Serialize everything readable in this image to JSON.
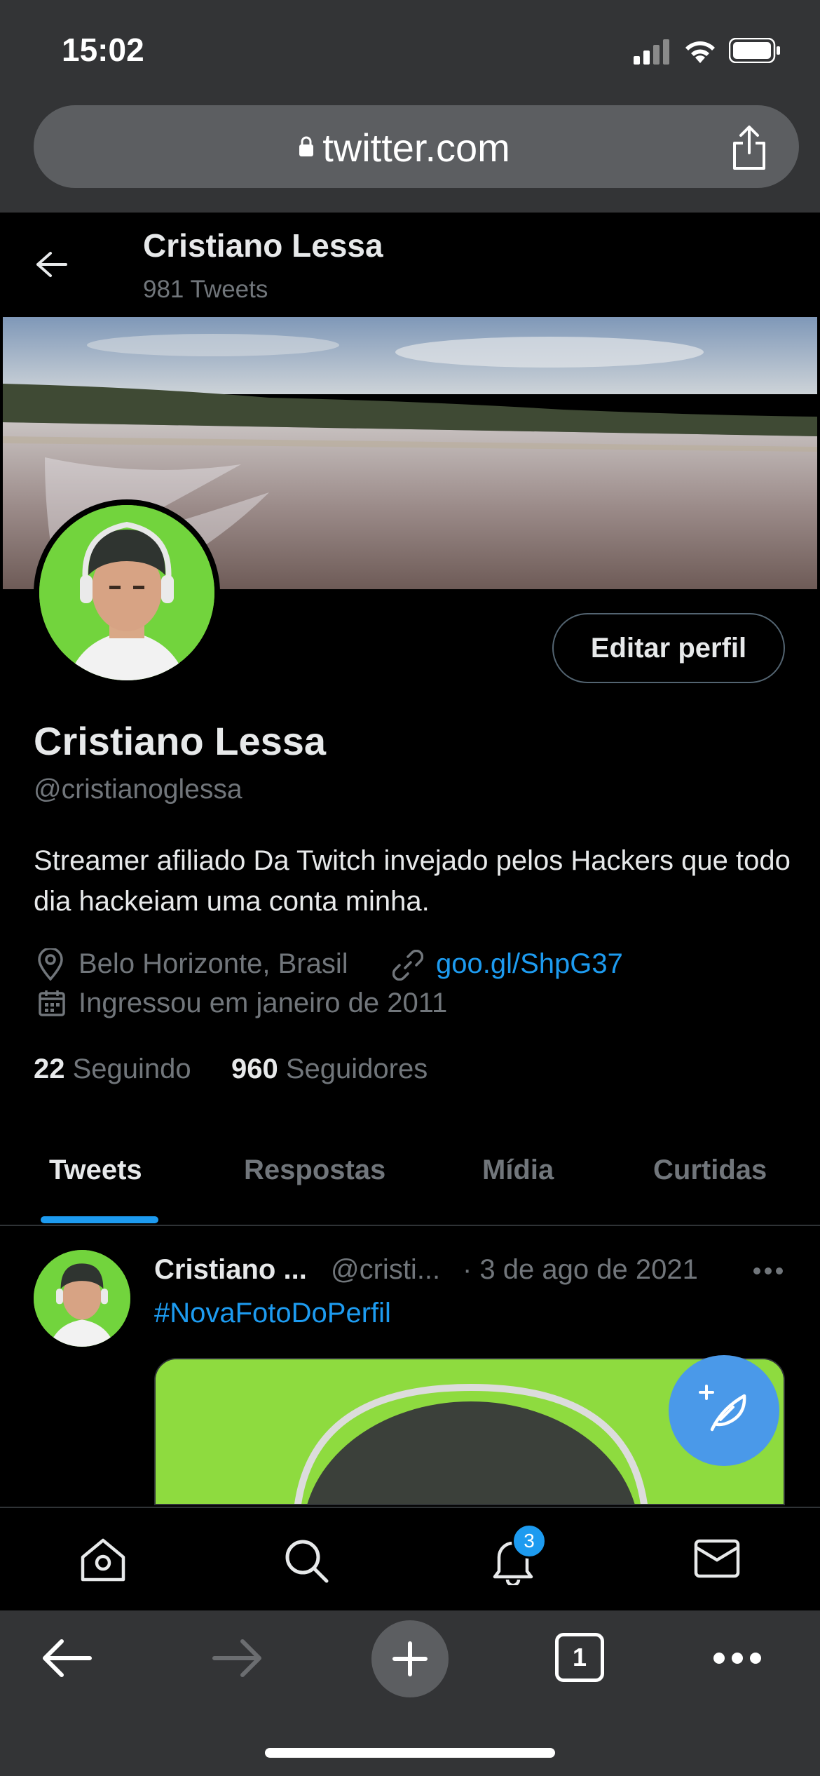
{
  "status_bar": {
    "time": "15:02"
  },
  "browser": {
    "url": "twitter.com"
  },
  "header": {
    "name": "Cristiano Lessa",
    "tweet_count": "981 Tweets"
  },
  "profile": {
    "edit_button": "Editar perfil",
    "display_name": "Cristiano Lessa",
    "handle": "@cristianoglessa",
    "bio": "Streamer afiliado Da Twitch invejado pelos Hackers que todo dia hackeiam uma conta minha.",
    "location": "Belo Horizonte, Brasil",
    "link": "goo.gl/ShpG37",
    "joined": "Ingressou em janeiro de 2011",
    "following_count": "22",
    "following_label": "Seguindo",
    "followers_count": "960",
    "followers_label": "Seguidores"
  },
  "tabs": [
    {
      "label": "Tweets",
      "active": true
    },
    {
      "label": "Respostas",
      "active": false
    },
    {
      "label": "Mídia",
      "active": false
    },
    {
      "label": "Curtidas",
      "active": false
    }
  ],
  "tweet": {
    "name": "Cristiano ...",
    "handle": "@cristi...",
    "date": "· 3 de ago de 2021",
    "text": "#NovaFotoDoPerfil"
  },
  "bottom_nav": {
    "notification_badge": "3"
  },
  "safari_toolbar": {
    "tab_count": "1"
  },
  "colors": {
    "accent": "#1d9bf0",
    "fab": "#4a99e9",
    "chrome": "#333436"
  }
}
